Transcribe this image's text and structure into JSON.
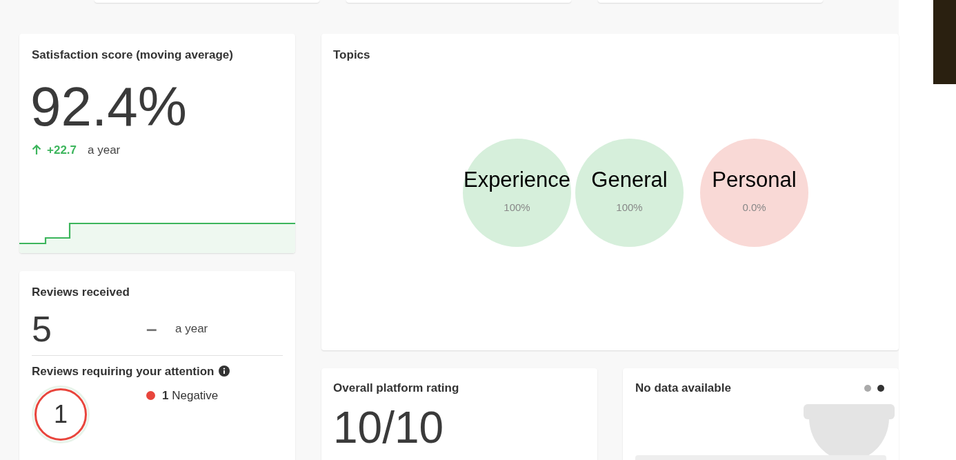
{
  "satisfaction": {
    "title": "Satisfaction score (moving average)",
    "value": "92.4%",
    "change": "+22.7",
    "period": "a year"
  },
  "reviews_received": {
    "title": "Reviews received",
    "value": "5",
    "change": "–",
    "period": "a year"
  },
  "attention": {
    "title": "Reviews requiring your attention",
    "total": "1",
    "legend": [
      {
        "count": "1",
        "label": "Negative",
        "color": "#e8453c"
      }
    ]
  },
  "topics": {
    "title": "Topics",
    "bubbles": [
      {
        "label": "Experience",
        "percent": "100%",
        "color": "#d6efdb"
      },
      {
        "label": "General",
        "percent": "100%",
        "color": "#d6efdb"
      },
      {
        "label": "Personal",
        "percent": "0.0%",
        "color": "#f9d9d6"
      }
    ]
  },
  "rating": {
    "title": "Overall platform rating",
    "value": "10/10"
  },
  "no_data": {
    "title": "No data available",
    "dots": [
      {
        "selected": false
      },
      {
        "selected": true
      }
    ]
  }
}
